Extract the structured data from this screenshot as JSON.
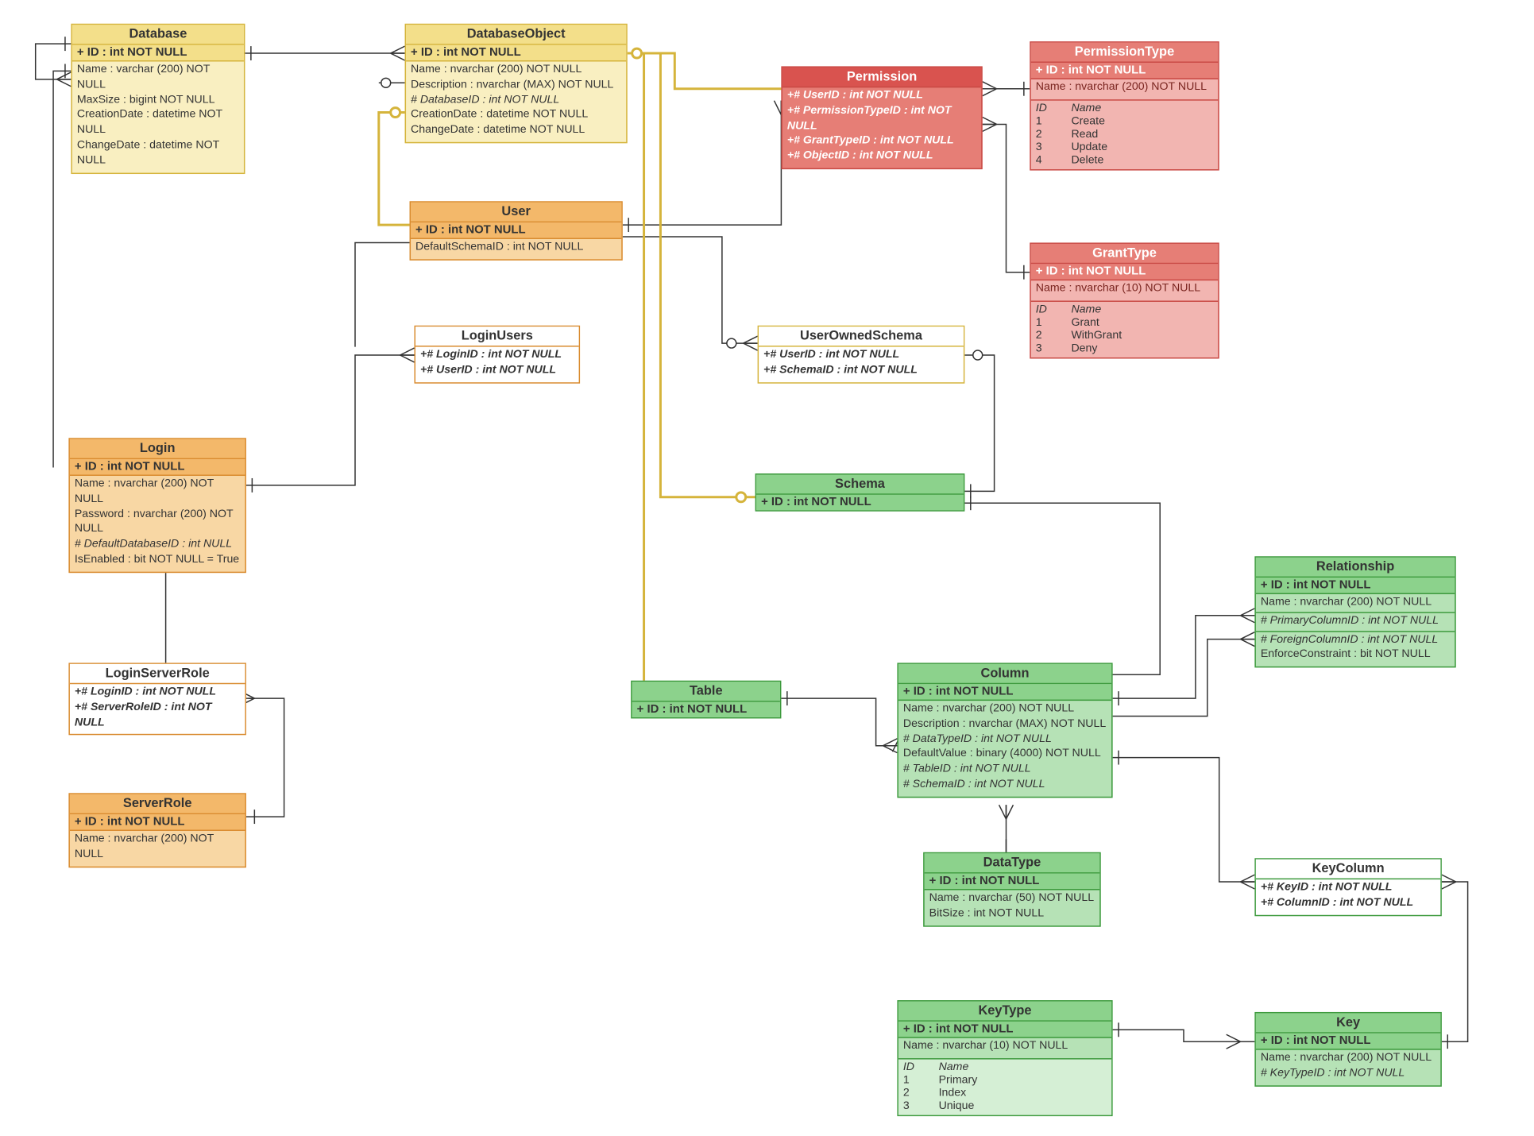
{
  "entities": {
    "Database": {
      "title": "Database",
      "pk": "+ ID : int NOT NULL",
      "attrs": [
        "Name : varchar (200)  NOT NULL",
        "MaxSize : bigint NOT NULL",
        "CreationDate : datetime NOT NULL",
        "ChangeDate : datetime NOT NULL"
      ]
    },
    "DatabaseObject": {
      "title": "DatabaseObject",
      "pk": "+ ID : int NOT NULL",
      "attrs": [
        "Name : nvarchar (200)  NOT NULL",
        "Description : nvarchar (MAX)  NOT NULL",
        "# DatabaseID : int NOT NULL",
        "CreationDate : datetime NOT NULL",
        "ChangeDate : datetime NOT NULL"
      ]
    },
    "Permission": {
      "title": "Permission",
      "attrs": [
        "+# UserID : int NOT NULL",
        "+# PermissionTypeID : int NOT NULL",
        "+# GrantTypeID : int NOT NULL",
        "+# ObjectID : int NOT NULL"
      ]
    },
    "PermissionType": {
      "title": "PermissionType",
      "pk": "+ ID : int NOT NULL",
      "attrs": [
        "Name : nvarchar (200)  NOT NULL"
      ],
      "rows_hdr": [
        "ID",
        "Name"
      ],
      "rows": [
        [
          "1",
          "Create"
        ],
        [
          "2",
          "Read"
        ],
        [
          "3",
          "Update"
        ],
        [
          "4",
          "Delete"
        ]
      ]
    },
    "User": {
      "title": "User",
      "pk": "+ ID : int NOT NULL",
      "attrs": [
        "DefaultSchemaID : int NOT NULL"
      ]
    },
    "GrantType": {
      "title": "GrantType",
      "pk": "+ ID : int NOT NULL",
      "attrs": [
        "Name : nvarchar (10)  NOT NULL"
      ],
      "rows_hdr": [
        "ID",
        "Name"
      ],
      "rows": [
        [
          "1",
          "Grant"
        ],
        [
          "2",
          "WithGrant"
        ],
        [
          "3",
          "Deny"
        ]
      ]
    },
    "LoginUsers": {
      "title": "LoginUsers",
      "attrs": [
        "+# LoginID : int NOT NULL",
        "+# UserID : int NOT NULL"
      ]
    },
    "UserOwnedSchema": {
      "title": "UserOwnedSchema",
      "attrs": [
        "+# UserID : int NOT NULL",
        "+# SchemaID : int NOT NULL"
      ]
    },
    "Login": {
      "title": "Login",
      "pk": "+ ID : int NOT NULL",
      "attrs": [
        "Name : nvarchar (200)  NOT NULL",
        "Password : nvarchar (200)  NOT NULL",
        "# DefaultDatabaseID : int NULL",
        "IsEnabled : bit NOT NULL = True"
      ]
    },
    "Schema": {
      "title": "Schema",
      "pk": "+ ID : int NOT NULL"
    },
    "Relationship": {
      "title": "Relationship",
      "pk": "+ ID : int NOT NULL",
      "attrs": [
        "Name : nvarchar (200)  NOT NULL",
        "# PrimaryColumnID : int NOT NULL",
        "# ForeignColumnID : int NOT NULL",
        "EnforceConstraint : bit NOT NULL"
      ]
    },
    "LoginServerRole": {
      "title": "LoginServerRole",
      "attrs": [
        "+# LoginID : int NOT NULL",
        "+# ServerRoleID : int NOT NULL"
      ]
    },
    "Table": {
      "title": "Table",
      "pk": "+ ID : int NOT NULL"
    },
    "Column": {
      "title": "Column",
      "pk": "+ ID : int NOT NULL",
      "attrs": [
        "Name : nvarchar (200)  NOT NULL",
        "Description : nvarchar (MAX)  NOT NULL",
        "# DataTypeID : int NOT NULL",
        "DefaultValue : binary (4000)  NOT NULL",
        "# TableID : int NOT NULL",
        "# SchemaID : int NOT NULL"
      ]
    },
    "ServerRole": {
      "title": "ServerRole",
      "pk": "+ ID : int NOT NULL",
      "attrs": [
        "Name : nvarchar (200)  NOT NULL"
      ]
    },
    "DataType": {
      "title": "DataType",
      "pk": "+ ID : int NOT NULL",
      "attrs": [
        "Name : nvarchar (50)  NOT NULL",
        "BitSize : int NOT NULL"
      ]
    },
    "KeyColumn": {
      "title": "KeyColumn",
      "attrs": [
        "+# KeyID : int NOT NULL",
        "+# ColumnID : int NOT NULL"
      ]
    },
    "KeyType": {
      "title": "KeyType",
      "pk": "+ ID : int NOT NULL",
      "attrs": [
        "Name : nvarchar (10)  NOT NULL"
      ],
      "rows_hdr": [
        "ID",
        "Name"
      ],
      "rows": [
        [
          "1",
          "Primary"
        ],
        [
          "2",
          "Index"
        ],
        [
          "3",
          "Unique"
        ]
      ]
    },
    "Key": {
      "title": "Key",
      "pk": "+ ID : int NOT NULL",
      "attrs": [
        "Name : nvarchar (200)  NOT NULL",
        "# KeyTypeID : int NOT NULL"
      ]
    }
  }
}
